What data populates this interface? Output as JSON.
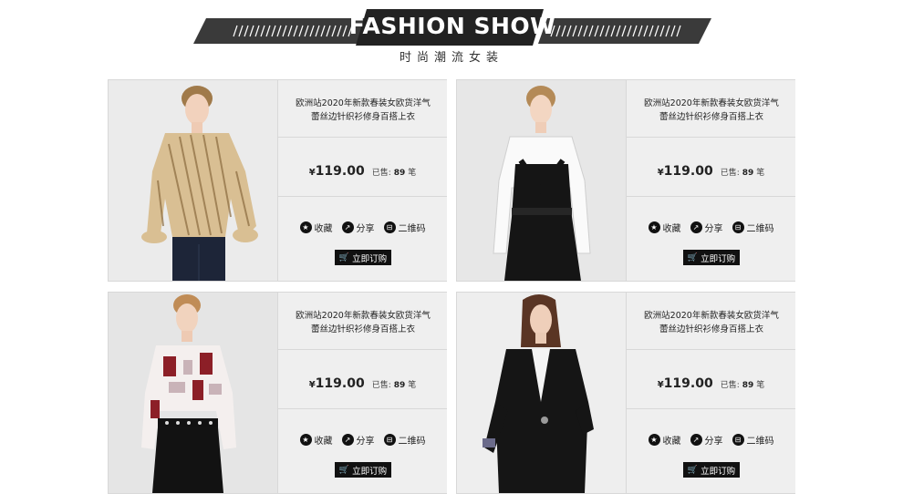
{
  "header": {
    "title": "FASHION SHOW",
    "subtitle": "时尚潮流女装"
  },
  "colors": {
    "accent": "#111111",
    "banner": "#2b2b2b",
    "card_bg": "#efefef",
    "border": "#d8d8d8"
  },
  "products": [
    {
      "title_line1": "欧洲站2020年新款春装女欧货洋气",
      "title_line2": "蕾丝边针织衫修身百搭上衣",
      "price_symbol": "¥",
      "price": "119.00",
      "sold_label": "已售:",
      "sold_count": "89",
      "sold_unit": "笔",
      "fav_label": "收藏",
      "share_label": "分享",
      "qr_label": "二维码",
      "buy_label": "立即订购"
    },
    {
      "title_line1": "欧洲站2020年新款春装女欧货洋气",
      "title_line2": "蕾丝边针织衫修身百搭上衣",
      "price_symbol": "¥",
      "price": "119.00",
      "sold_label": "已售:",
      "sold_count": "89",
      "sold_unit": "笔",
      "fav_label": "收藏",
      "share_label": "分享",
      "qr_label": "二维码",
      "buy_label": "立即订购"
    },
    {
      "title_line1": "欧洲站2020年新款春装女欧货洋气",
      "title_line2": "蕾丝边针织衫修身百搭上衣",
      "price_symbol": "¥",
      "price": "119.00",
      "sold_label": "已售:",
      "sold_count": "89",
      "sold_unit": "笔",
      "fav_label": "收藏",
      "share_label": "分享",
      "qr_label": "二维码",
      "buy_label": "立即订购"
    },
    {
      "title_line1": "欧洲站2020年新款春装女欧货洋气",
      "title_line2": "蕾丝边针织衫修身百搭上衣",
      "price_symbol": "¥",
      "price": "119.00",
      "sold_label": "已售:",
      "sold_count": "89",
      "sold_unit": "笔",
      "fav_label": "收藏",
      "share_label": "分享",
      "qr_label": "二维码",
      "buy_label": "立即订购"
    }
  ],
  "icons": [
    "star-icon",
    "share-icon",
    "qrcode-icon",
    "cart-icon"
  ]
}
